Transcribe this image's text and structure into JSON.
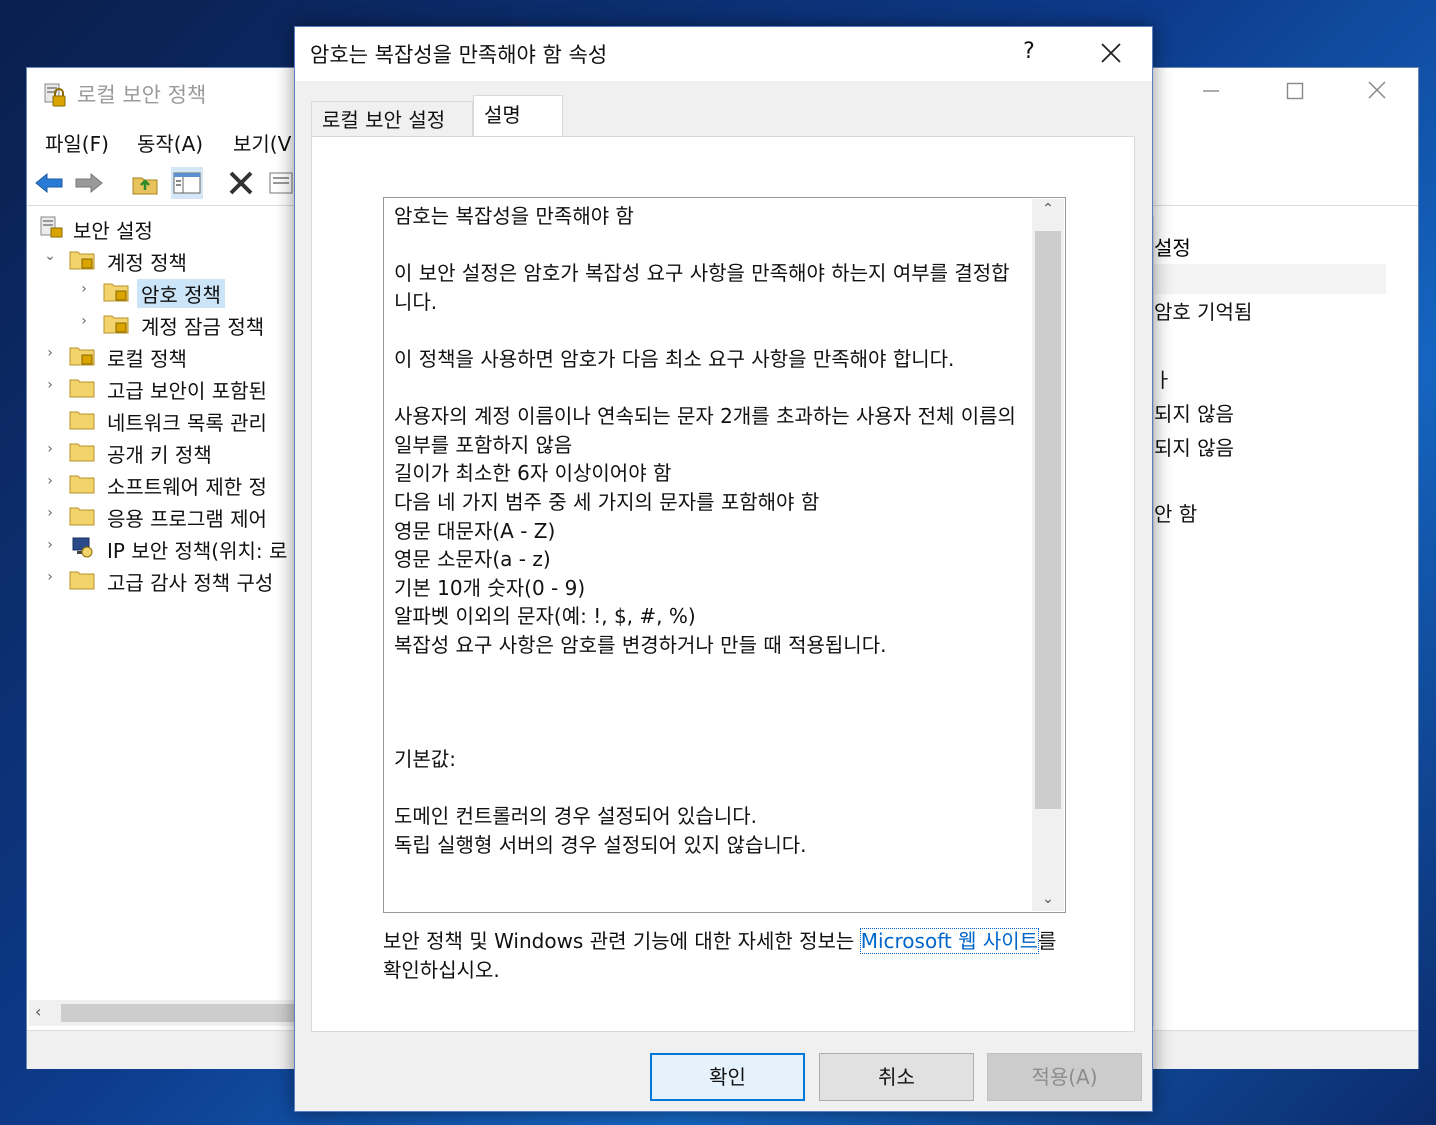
{
  "colors": {
    "accent": "#0078d7",
    "link": "#0066cc",
    "selection": "#cce4f7"
  },
  "mmc": {
    "title": "로컬 보안 정책",
    "menu": [
      "파일(F)",
      "동작(A)",
      "보기(V"
    ],
    "toolbar_icons": [
      "back-arrow-icon",
      "forward-arrow-icon",
      "up-folder-icon",
      "show-hide-tree-icon",
      "delete-icon",
      "properties-icon"
    ],
    "tree": {
      "root": "보안 설정",
      "items": [
        {
          "label": "계정 정책",
          "expanded": true
        },
        {
          "label": "암호 정책",
          "selected": true
        },
        {
          "label": "계정 잠금 정책"
        },
        {
          "label": "로컬 정책"
        },
        {
          "label": "고급 보안이 포함된"
        },
        {
          "label": "네트워크 목록 관리"
        },
        {
          "label": "공개 키 정책"
        },
        {
          "label": "소프트웨어 제한 정"
        },
        {
          "label": "응용 프로그램 제어"
        },
        {
          "label": "IP 보안 정책(위치: 로"
        },
        {
          "label": "고급 감사 정책 구성"
        }
      ]
    },
    "right_pane": {
      "header": "설정",
      "items": [
        "암호 기억됨",
        "ㅏ",
        "되지 않음",
        "되지 않음",
        "안 함"
      ]
    }
  },
  "dialog": {
    "title": "암호는 복잡성을 만족해야 함 속성",
    "help_label": "?",
    "tabs": [
      {
        "label": "로컬 보안 설정"
      },
      {
        "label": "설명",
        "active": true
      }
    ],
    "description": "암호는 복잡성을 만족해야 함\n\n이 보안 설정은 암호가 복잡성 요구 사항을 만족해야 하는지 여부를 결정합니다.\n\n이 정책을 사용하면 암호가 다음 최소 요구 사항을 만족해야 합니다.\n\n사용자의 계정 이름이나 연속되는 문자 2개를 초과하는 사용자 전체 이름의 일부를 포함하지 않음\n길이가 최소한 6자 이상이어야 함\n다음 네 가지 범주 중 세 가지의 문자를 포함해야 함\n영문 대문자(A - Z)\n영문 소문자(a - z)\n기본 10개 숫자(0 - 9)\n알파벳 이외의 문자(예: !, $, #, %)\n복잡성 요구 사항은 암호를 변경하거나 만들 때 적용됩니다.\n\n\n\n기본값:\n\n도메인 컨트롤러의 경우 설정되어 있습니다.\n독립 실행형 서버의 경우 설정되어 있지 않습니다.",
    "footer": {
      "before": "보안 정책 및 Windows 관련 기능에 대한 자세한 정보는 ",
      "link": "Microsoft 웹 사이트",
      "after": "를 확인하십시오."
    },
    "buttons": {
      "ok": "확인",
      "cancel": "취소",
      "apply": "적용(A)"
    }
  }
}
